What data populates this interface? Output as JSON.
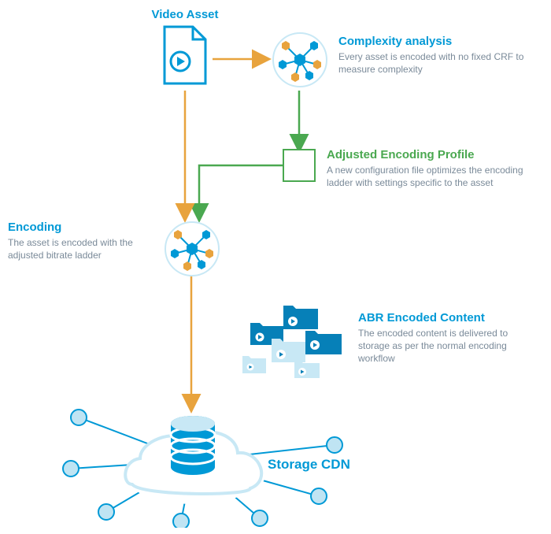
{
  "nodes": {
    "video_asset": {
      "title": "Video Asset"
    },
    "complexity": {
      "title": "Complexity analysis",
      "desc": "Every asset is encoded with no fixed CRF to measure complexity"
    },
    "adjusted_profile": {
      "title": "Adjusted Encoding Profile",
      "desc": "A new configuration file optimizes the encoding ladder with settings specific to the asset"
    },
    "encoding": {
      "title": "Encoding",
      "desc": "The asset is encoded with the adjusted bitrate ladder"
    },
    "abr": {
      "title": "ABR Encoded Content",
      "desc": "The encoded content is delivered to storage as per the normal encoding workflow"
    },
    "storage": {
      "title": "Storage CDN"
    }
  },
  "colors": {
    "blue": "#0099d6",
    "green": "#4aa850",
    "orange": "#e8a33d",
    "light_blue": "#c8e8f5",
    "grey": "#7a8a99"
  }
}
